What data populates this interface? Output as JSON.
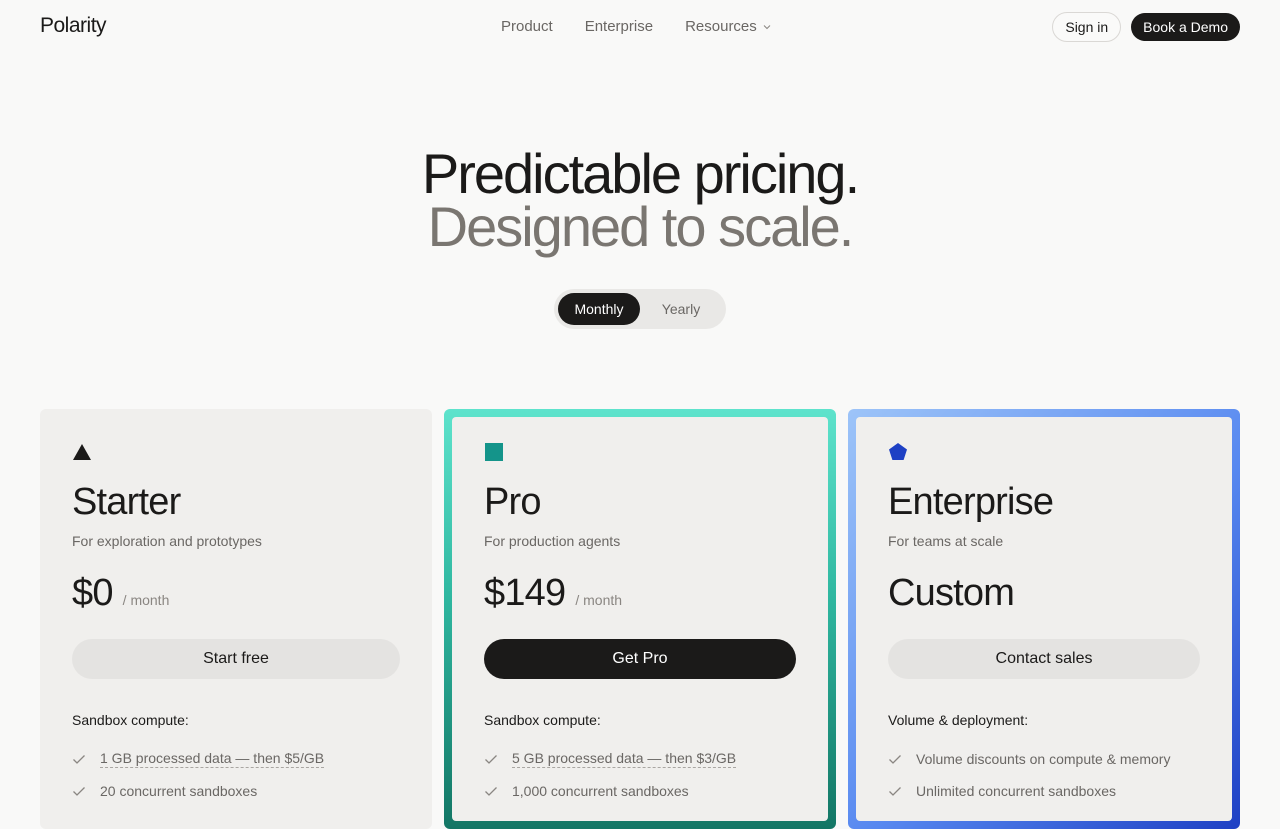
{
  "header": {
    "logo": "Polarity",
    "nav": [
      {
        "label": "Product"
      },
      {
        "label": "Enterprise"
      },
      {
        "label": "Resources"
      }
    ],
    "signin_label": "Sign in",
    "demo_label": "Book a Demo"
  },
  "hero": {
    "title": "Predictable pricing.",
    "subtitle": "Designed to scale."
  },
  "billing_toggle": {
    "options": [
      "Monthly",
      "Yearly"
    ],
    "selected": "Monthly"
  },
  "plans": [
    {
      "icon": "triangle-icon",
      "color": "#1b1a19",
      "name": "Starter",
      "tagline": "For exploration and prototypes",
      "price": "$0",
      "period": "/ month",
      "cta": "Start free",
      "features_heading": "Sandbox compute:",
      "features": [
        "1 GB processed data — then $5/GB",
        "20 concurrent sandboxes"
      ]
    },
    {
      "icon": "square-icon",
      "color": "#14948a",
      "name": "Pro",
      "tagline": "For production agents",
      "price": "$149",
      "period": "/ month",
      "cta": "Get Pro",
      "features_heading": "Sandbox compute:",
      "features": [
        "5 GB processed data — then $3/GB",
        "1,000 concurrent sandboxes"
      ]
    },
    {
      "icon": "pentagon-icon",
      "color": "#1e40c4",
      "name": "Enterprise",
      "tagline": "For teams at scale",
      "price": "Custom",
      "period": "",
      "cta": "Contact sales",
      "features_heading": "Volume & deployment:",
      "features": [
        "Volume discounts on compute & memory",
        "Unlimited concurrent sandboxes"
      ]
    }
  ]
}
